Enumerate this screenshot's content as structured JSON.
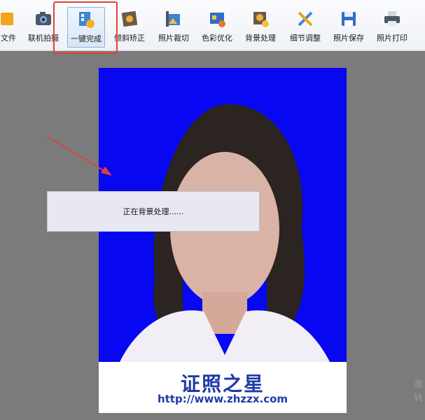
{
  "toolbar": {
    "items": [
      {
        "label": "文件",
        "icon": "folder-icon"
      },
      {
        "label": "联机拍摄",
        "icon": "camera-icon"
      },
      {
        "label": "一键完成",
        "icon": "one-click-icon",
        "active": true
      },
      {
        "label": "倾斜矫正",
        "icon": "tilt-correct-icon"
      },
      {
        "label": "照片裁切",
        "icon": "crop-icon"
      },
      {
        "label": "色彩优化",
        "icon": "color-optimize-icon"
      },
      {
        "label": "背景处理",
        "icon": "background-icon"
      },
      {
        "label": "细节调整",
        "icon": "detail-adjust-icon"
      },
      {
        "label": "照片保存",
        "icon": "save-icon"
      },
      {
        "label": "照片打印",
        "icon": "print-icon"
      }
    ]
  },
  "photo": {
    "background_color": "#0707f2",
    "brand_title": "证照之星",
    "brand_url": "http://www.zhzzx.com"
  },
  "dialog": {
    "message": "正在背景处理......"
  },
  "watermark": {
    "text": "激 转"
  },
  "colors": {
    "accent_red": "#e0413b",
    "brand_blue": "#1f3aa8"
  }
}
